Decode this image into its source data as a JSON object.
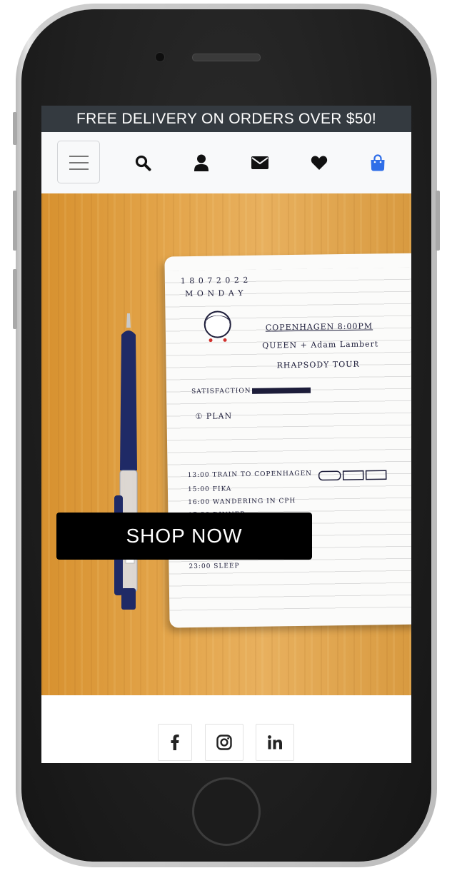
{
  "banner": {
    "text": "FREE DELIVERY ON ORDERS OVER $50!"
  },
  "nav": {
    "icons": [
      "menu-toggle",
      "search-icon",
      "user-icon",
      "envelope-icon",
      "heart-icon",
      "shopping-bag-icon"
    ]
  },
  "hero": {
    "cta_label": "SHOP NOW"
  },
  "footer": {
    "social": [
      "facebook-icon",
      "instagram-icon",
      "linkedin-icon"
    ]
  },
  "colors": {
    "banner_bg": "#343a40",
    "cta_bg": "#000000",
    "bag_accent": "#2f6ee8",
    "icon_dark": "#111111"
  }
}
